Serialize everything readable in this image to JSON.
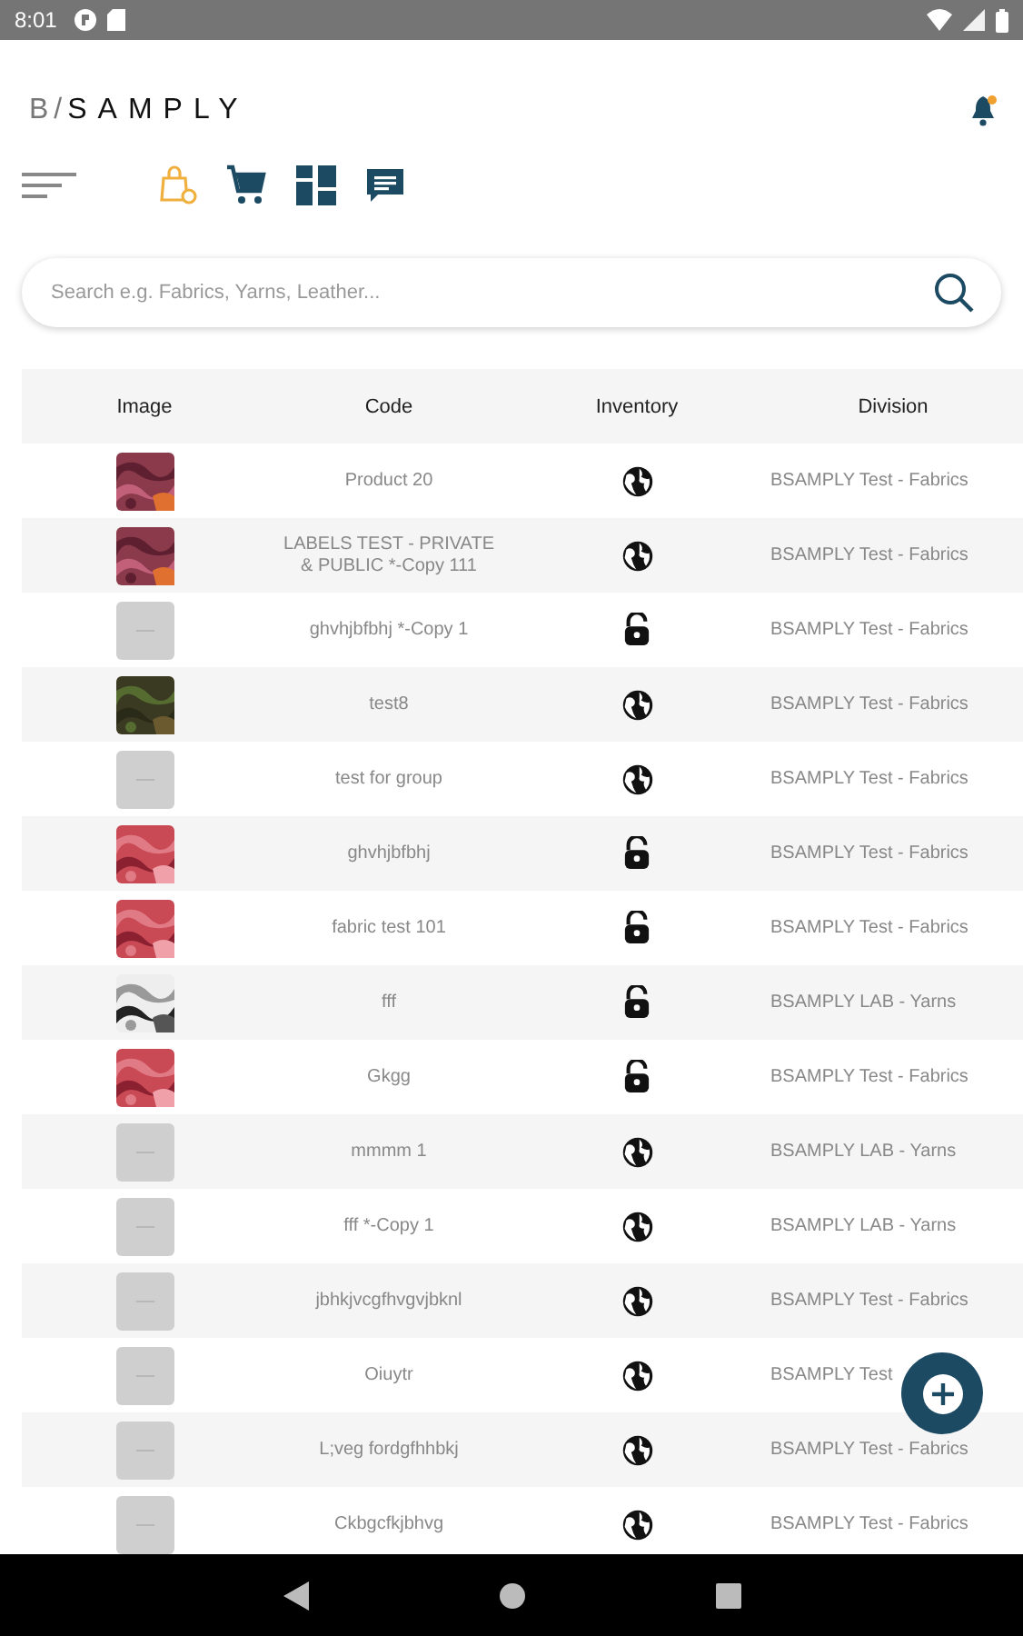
{
  "status_bar": {
    "time": "8:01"
  },
  "header": {
    "logo_mark": "B/",
    "logo_name": "SAMPLY",
    "notification_badge": true
  },
  "toolbar": [
    {
      "kind": "bag",
      "selected": true
    },
    {
      "kind": "cart",
      "selected": false
    },
    {
      "kind": "dashboard",
      "selected": false
    },
    {
      "kind": "chat",
      "selected": false
    }
  ],
  "search": {
    "placeholder": "Search e.g. Fabrics, Yarns, Leather..."
  },
  "table": {
    "columns": [
      "Image",
      "Code",
      "Inventory",
      "Division"
    ],
    "rows": [
      {
        "code": "Product 20",
        "inventory": {
          "kind": "public"
        },
        "division": "BSAMPLY Test - Fabrics"
      },
      {
        "code": "LABELS TEST - PRIVATE & PUBLIC *-Copy 111",
        "inventory": {
          "kind": "public"
        },
        "division": "BSAMPLY Test - Fabrics"
      },
      {
        "image": {
          "kind": "placeholder"
        },
        "code": "ghvhjbfbhj *-Copy 1",
        "inventory": {
          "kind": "private"
        },
        "division": "BSAMPLY Test - Fabrics"
      },
      {
        "code": "test8",
        "inventory": {
          "kind": "public"
        },
        "division": "BSAMPLY Test - Fabrics"
      },
      {
        "image": {
          "kind": "placeholder"
        },
        "code": "test for group",
        "inventory": {
          "kind": "public"
        },
        "division": "BSAMPLY Test - Fabrics"
      },
      {
        "code": "ghvhjbfbhj",
        "inventory": {
          "kind": "private"
        },
        "division": "BSAMPLY Test - Fabrics"
      },
      {
        "code": "fabric test 101",
        "inventory": {
          "kind": "private"
        },
        "division": "BSAMPLY Test - Fabrics"
      },
      {
        "code": "fff",
        "inventory": {
          "kind": "private"
        },
        "division": "BSAMPLY LAB - Yarns"
      },
      {
        "code": "Gkgg",
        "inventory": {
          "kind": "private"
        },
        "division": "BSAMPLY Test - Fabrics"
      },
      {
        "image": {
          "kind": "placeholder"
        },
        "code": "mmmm 1",
        "inventory": {
          "kind": "public"
        },
        "division": "BSAMPLY LAB - Yarns"
      },
      {
        "image": {
          "kind": "placeholder"
        },
        "code": "fff *-Copy 1",
        "inventory": {
          "kind": "public"
        },
        "division": "BSAMPLY LAB - Yarns"
      },
      {
        "image": {
          "kind": "placeholder"
        },
        "code": "jbhkjvcgfhvgvjbknl",
        "inventory": {
          "kind": "public"
        },
        "division": "BSAMPLY Test - Fabrics"
      },
      {
        "image": {
          "kind": "placeholder"
        },
        "code": "Oiuytr",
        "inventory": {
          "kind": "public"
        },
        "division": "BSAMPLY Test"
      },
      {
        "image": {
          "kind": "placeholder"
        },
        "code": "L;veg fordgfhhbkj",
        "inventory": {
          "kind": "public"
        },
        "division": "BSAMPLY Test - Fabrics"
      },
      {
        "image": {
          "kind": "placeholder"
        },
        "code": "Ckbgcfkjbhvg",
        "inventory": {
          "kind": "public"
        },
        "division": "BSAMPLY Test - Fabrics"
      }
    ]
  }
}
